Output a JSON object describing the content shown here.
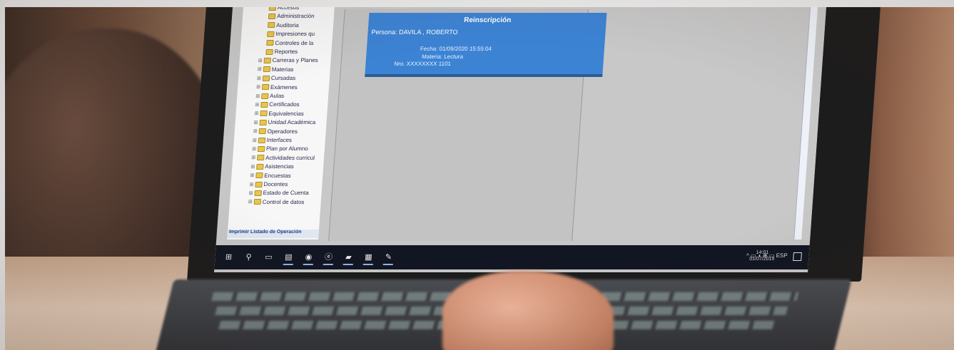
{
  "tree": {
    "items": [
      {
        "label": "Accesos",
        "expander": ""
      },
      {
        "label": "Administración",
        "expander": ""
      },
      {
        "label": "Auditoria",
        "expander": ""
      },
      {
        "label": "Impresiones qu",
        "expander": ""
      },
      {
        "label": "Controles de la",
        "expander": ""
      },
      {
        "label": "Reportes",
        "expander": ""
      },
      {
        "label": "Carreras y Planes",
        "expander": "⊞"
      },
      {
        "label": "Materias",
        "expander": "⊞"
      },
      {
        "label": "Cursadas",
        "expander": "⊞"
      },
      {
        "label": "Exámenes",
        "expander": "⊞"
      },
      {
        "label": "Aulas",
        "expander": "⊞"
      },
      {
        "label": "Certificados",
        "expander": "⊞"
      },
      {
        "label": "Equivalencias",
        "expander": "⊞"
      },
      {
        "label": "Unidad Académica",
        "expander": "⊞"
      },
      {
        "label": "Operadores",
        "expander": "⊞"
      },
      {
        "label": "Interfaces",
        "expander": "⊞"
      },
      {
        "label": "Plan por Alumno",
        "expander": "⊞"
      },
      {
        "label": "Actividades curricul",
        "expander": "⊞"
      },
      {
        "label": "Asistencias",
        "expander": "⊞"
      },
      {
        "label": "Encuestas",
        "expander": "⊞"
      },
      {
        "label": "Docentes",
        "expander": "⊞"
      },
      {
        "label": "Estado de Cuenta",
        "expander": "⊞"
      },
      {
        "label": "Control de datos",
        "expander": "⊞"
      }
    ],
    "status_label": "Imprimir Listado de Operación"
  },
  "card": {
    "title": "Reinscripción",
    "person": "Persona: DAVILA , ROBERTO",
    "line1": "Fecha: 01/09/2020 15:55:04",
    "line2": "Materia: Lectura",
    "line3": "Nro. XXXXXXXX 1101"
  },
  "taskbar": {
    "icons": [
      {
        "name": "windows-start-icon",
        "glyph": "⊞"
      },
      {
        "name": "search-icon",
        "glyph": "⚲"
      },
      {
        "name": "task-view-icon",
        "glyph": "▭"
      },
      {
        "name": "file-explorer-icon",
        "glyph": "▤"
      },
      {
        "name": "chrome-icon",
        "glyph": "◉"
      },
      {
        "name": "edge-icon",
        "glyph": "ⓔ"
      },
      {
        "name": "app-icon",
        "glyph": "▰"
      },
      {
        "name": "grid-app-icon",
        "glyph": "▦"
      },
      {
        "name": "tools-icon",
        "glyph": "✎"
      }
    ],
    "tray_text": "^ ▭ ◖ ⊕ ▭ ESP",
    "time": "14:01",
    "date": "01/07/2019"
  },
  "colors": {
    "card_blue": "#3c83d4",
    "taskbar": "#111622",
    "folder": "#e7c650"
  }
}
